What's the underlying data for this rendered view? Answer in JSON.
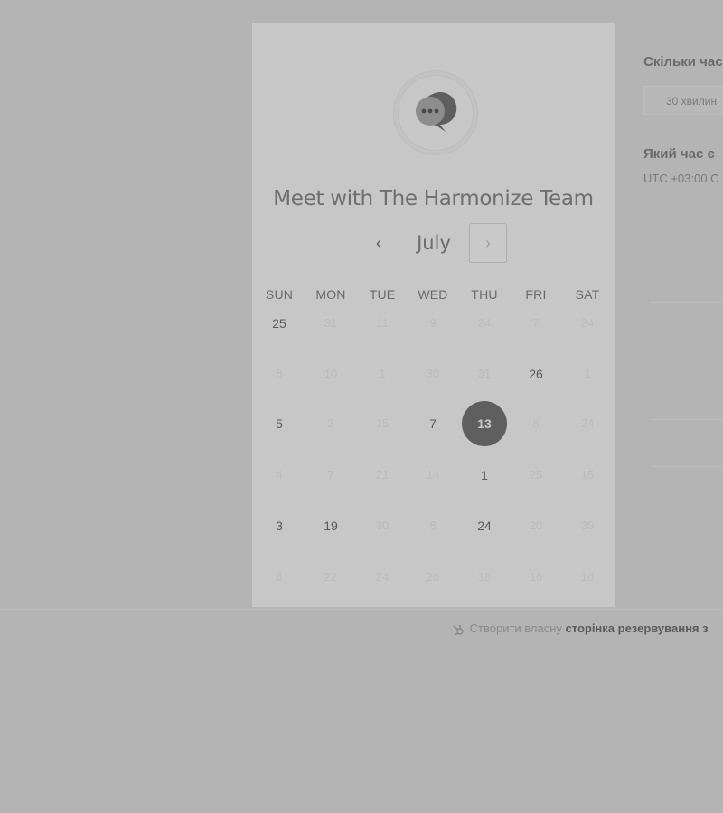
{
  "header": {
    "title": "Meet with The Harmonize Team"
  },
  "calendar": {
    "month": "July",
    "prev_symbol": "‹",
    "next_symbol": "›",
    "weekdays": [
      "SUN",
      "MON",
      "TUE",
      "WED",
      "THU",
      "FRI",
      "SAT"
    ],
    "weeks": [
      [
        {
          "label": "25",
          "state": "available"
        },
        {
          "label": "31",
          "state": "unavailable"
        },
        {
          "label": "11",
          "state": "unavailable"
        },
        {
          "label": "9",
          "state": "unavailable"
        },
        {
          "label": "24",
          "state": "unavailable"
        },
        {
          "label": "7",
          "state": "unavailable"
        },
        {
          "label": "24",
          "state": "unavailable"
        }
      ],
      [
        {
          "label": "8",
          "state": "unavailable"
        },
        {
          "label": "10",
          "state": "unavailable"
        },
        {
          "label": "1",
          "state": "unavailable"
        },
        {
          "label": "30",
          "state": "unavailable"
        },
        {
          "label": "31",
          "state": "unavailable"
        },
        {
          "label": "26",
          "state": "available"
        },
        {
          "label": "1",
          "state": "unavailable"
        }
      ],
      [
        {
          "label": "5",
          "state": "available"
        },
        {
          "label": "2",
          "state": "unavailable"
        },
        {
          "label": "15",
          "state": "unavailable"
        },
        {
          "label": "7",
          "state": "available"
        },
        {
          "label": "13",
          "state": "selected"
        },
        {
          "label": "8",
          "state": "unavailable"
        },
        {
          "label": "24",
          "state": "unavailable"
        }
      ],
      [
        {
          "label": "4",
          "state": "unavailable"
        },
        {
          "label": "7",
          "state": "unavailable"
        },
        {
          "label": "21",
          "state": "unavailable"
        },
        {
          "label": "14",
          "state": "unavailable"
        },
        {
          "label": "1",
          "state": "available"
        },
        {
          "label": "25",
          "state": "unavailable"
        },
        {
          "label": "15",
          "state": "unavailable"
        }
      ],
      [
        {
          "label": "3",
          "state": "available"
        },
        {
          "label": "19",
          "state": "available"
        },
        {
          "label": "30",
          "state": "unavailable"
        },
        {
          "label": "8",
          "state": "unavailable"
        },
        {
          "label": "24",
          "state": "available"
        },
        {
          "label": "20",
          "state": "unavailable"
        },
        {
          "label": "30",
          "state": "unavailable"
        }
      ],
      [
        {
          "label": "6",
          "state": "unavailable"
        },
        {
          "label": "22",
          "state": "unavailable"
        },
        {
          "label": "24",
          "state": "unavailable"
        },
        {
          "label": "26",
          "state": "unavailable"
        },
        {
          "label": "18",
          "state": "unavailable"
        },
        {
          "label": "16",
          "state": "unavailable"
        },
        {
          "label": "16",
          "state": "unavailable"
        }
      ]
    ]
  },
  "sidebar": {
    "duration_heading": "Скільки час",
    "duration_value": "30 хвилин",
    "time_heading": "Який час є",
    "timezone": "UTC +03:00 С"
  },
  "footer": {
    "prefix": "Створити власну",
    "link": "сторінка резервування з"
  },
  "colors": {
    "background": "#b4b4b4",
    "card": "#c7c7c7",
    "selected_day": "#5f5f5f"
  }
}
